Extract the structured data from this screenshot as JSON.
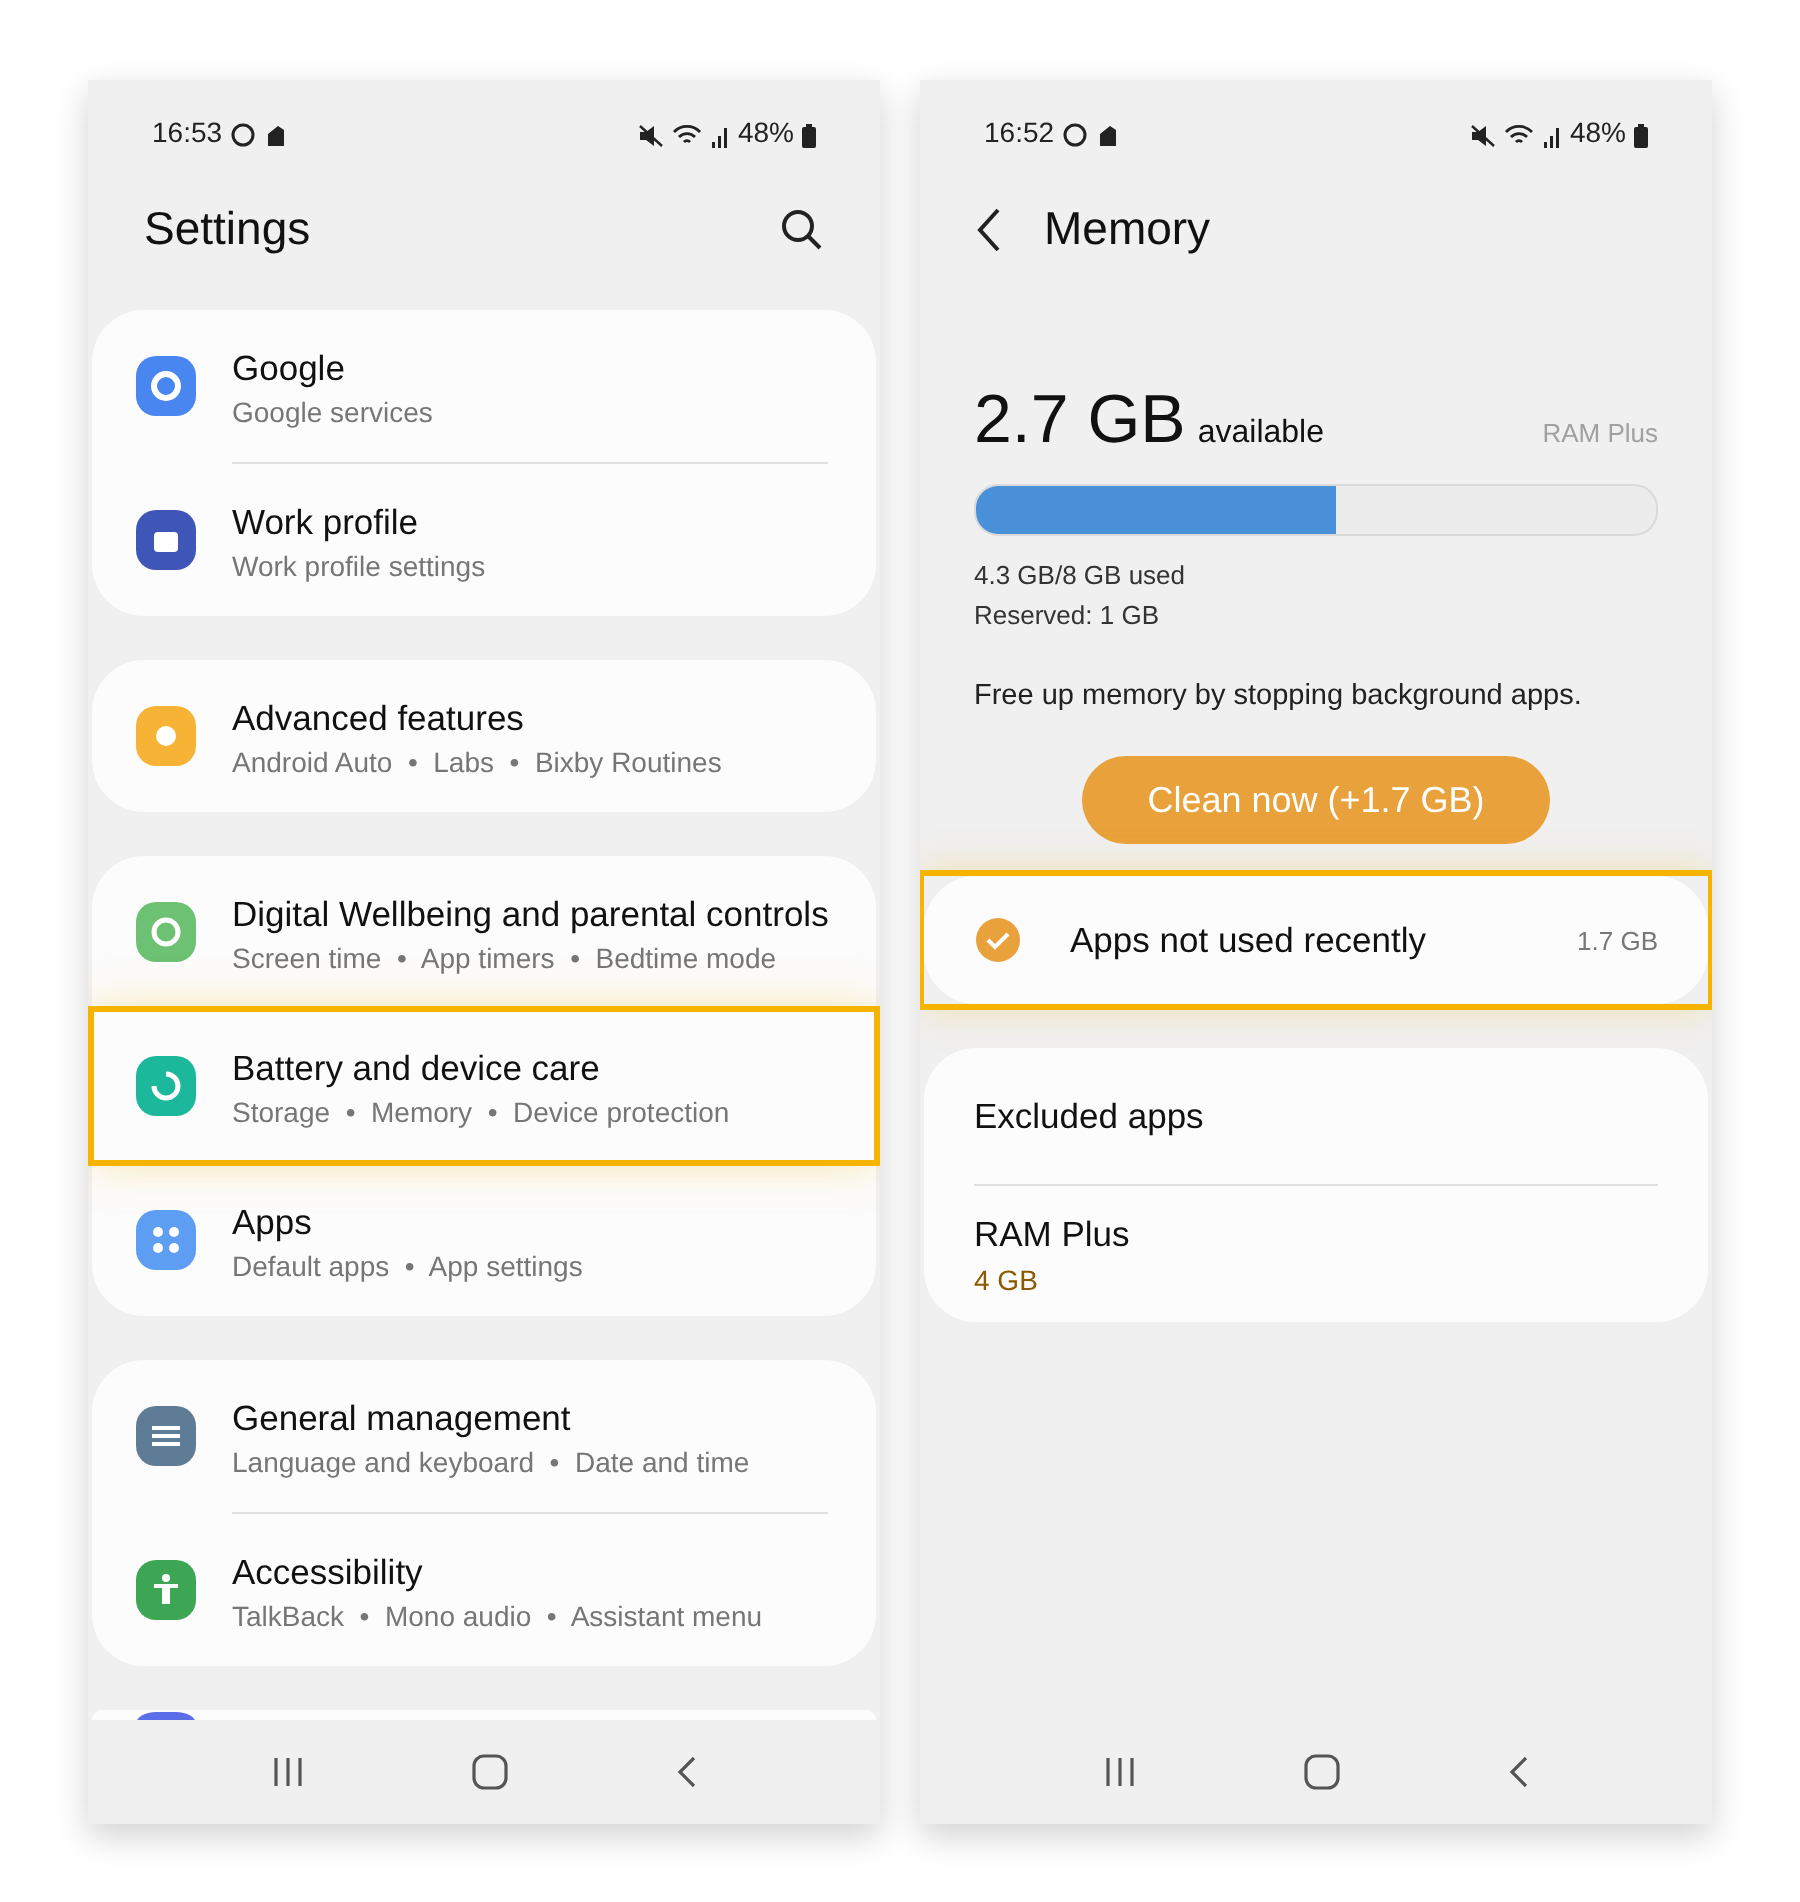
{
  "left": {
    "status_bar": {
      "time": "16:53",
      "battery": "48%"
    },
    "title": "Settings",
    "cards": [
      {
        "items": [
          {
            "title": "Google",
            "subtitle": "Google services",
            "color": "#4a86f0",
            "highlighted": false
          },
          {
            "title": "Work profile",
            "subtitle": "Work profile settings",
            "color": "#3e56b8",
            "highlighted": false
          }
        ]
      },
      {
        "items": [
          {
            "title": "Advanced features",
            "subtitle": "Android Auto  •  Labs  •  Bixby Routines",
            "color": "#f6b336",
            "highlighted": false
          }
        ]
      },
      {
        "items": [
          {
            "title": "Digital Wellbeing and parental controls",
            "subtitle": "Screen time  •  App timers  •  Bedtime mode",
            "color": "#6cc172",
            "highlighted": false
          },
          {
            "title": "Battery and device care",
            "subtitle": "Storage  •  Memory  •  Device protection",
            "color": "#1cb89c",
            "highlighted": true
          },
          {
            "title": "Apps",
            "subtitle": "Default apps  •  App settings",
            "color": "#5d9ef2",
            "highlighted": false
          }
        ]
      },
      {
        "items": [
          {
            "title": "General management",
            "subtitle": "Language and keyboard  •  Date and time",
            "color": "#5e7c96",
            "highlighted": false
          },
          {
            "title": "Accessibility",
            "subtitle": "TalkBack  •  Mono audio  •  Assistant menu",
            "color": "#3ca655",
            "highlighted": false
          }
        ]
      }
    ]
  },
  "right": {
    "status_bar": {
      "time": "16:52",
      "battery": "48%"
    },
    "title": "Memory",
    "available": "2.7 GB",
    "available_label": "available",
    "ram_plus_label": "RAM Plus",
    "usage": {
      "level": 0.53,
      "used": "4.3 GB/8 GB used",
      "reserved": "Reserved: 1 GB"
    },
    "hint": "Free up memory by stopping background apps.",
    "clean_button": "Clean now (+1.7 GB)",
    "apps_row": {
      "label": "Apps not used recently",
      "size": "1.7 GB",
      "checked": true,
      "highlighted": true
    },
    "options": [
      {
        "title": "Excluded apps"
      },
      {
        "title": "RAM Plus",
        "subtitle": "4 GB"
      }
    ]
  }
}
